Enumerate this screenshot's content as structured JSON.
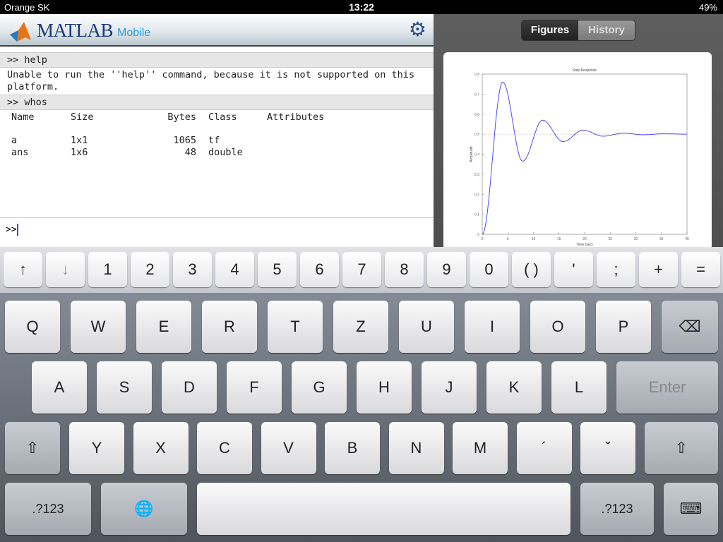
{
  "status": {
    "carrier": "Orange SK",
    "time": "13:22",
    "battery": "49%"
  },
  "header": {
    "brand": "MATLAB",
    "product": "Mobile",
    "settings_icon": "gear-icon"
  },
  "console": {
    "entries": [
      {
        "cmd": ">> help",
        "output": "Unable to run the ''help'' command, because it is not supported on this platform."
      },
      {
        "cmd": ">> whos"
      }
    ],
    "whos": {
      "headers": [
        "Name",
        "Size",
        "Bytes",
        "Class",
        "Attributes"
      ],
      "rows": [
        [
          "a",
          "1x1",
          "1065",
          "tf",
          ""
        ],
        [
          "ans",
          "1x6",
          "48",
          "double",
          ""
        ]
      ]
    },
    "prompt": ">>"
  },
  "figures": {
    "tabs": [
      "Figures",
      "History"
    ],
    "active": "Figures"
  },
  "chart_data": {
    "type": "line",
    "title": "Step Response",
    "xlabel": "Time (sec)",
    "ylabel": "Amplitude",
    "xlim": [
      0,
      40
    ],
    "ylim": [
      0,
      0.8
    ],
    "xticks": [
      0,
      5,
      10,
      15,
      20,
      25,
      30,
      35,
      40
    ],
    "yticks": [
      0,
      0.1,
      0.2,
      0.3,
      0.4,
      0.5,
      0.6,
      0.7,
      0.8
    ],
    "reference_line": 0.5,
    "color": "#4a4aff",
    "points": [
      [
        0,
        0
      ],
      [
        4,
        0.76
      ],
      [
        7.9,
        0.365
      ],
      [
        11.8,
        0.57
      ],
      [
        15.8,
        0.463
      ],
      [
        19.7,
        0.52
      ],
      [
        23.6,
        0.49
      ],
      [
        27.6,
        0.505
      ],
      [
        31.5,
        0.497
      ],
      [
        35.5,
        0.502
      ],
      [
        40,
        0.5
      ]
    ]
  },
  "keyboard": {
    "numrow": [
      "↑",
      "↓",
      "1",
      "2",
      "3",
      "4",
      "5",
      "6",
      "7",
      "8",
      "9",
      "0",
      "( )",
      "'",
      ";",
      "+",
      "="
    ],
    "row1": [
      "Q",
      "W",
      "E",
      "R",
      "T",
      "Z",
      "U",
      "I",
      "O",
      "P"
    ],
    "row2": [
      "A",
      "S",
      "D",
      "F",
      "G",
      "H",
      "J",
      "K",
      "L"
    ],
    "row3": [
      "Y",
      "X",
      "C",
      "V",
      "B",
      "N",
      "M",
      "´",
      "ˇ"
    ],
    "enter": "Enter",
    "backspace": "⌫",
    "shift": "⇧",
    "num": ".?123",
    "globe": "🌐",
    "hide": "⌨"
  }
}
